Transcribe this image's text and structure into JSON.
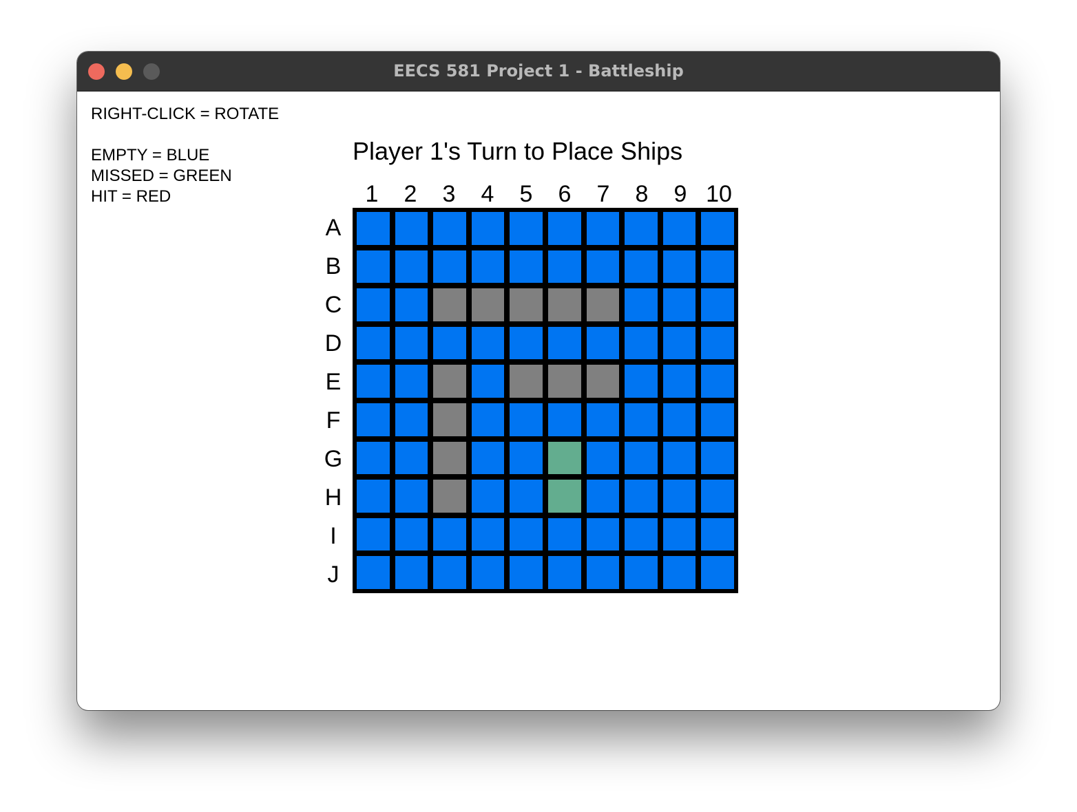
{
  "window": {
    "title": "EECS 581 Project 1 - Battleship"
  },
  "legend": {
    "rotate": "RIGHT-CLICK = ROTATE",
    "empty": "EMPTY = BLUE",
    "missed": "MISSED = GREEN",
    "hit": "HIT = RED"
  },
  "heading": "Player 1's Turn to Place Ships",
  "board": {
    "columns": [
      "1",
      "2",
      "3",
      "4",
      "5",
      "6",
      "7",
      "8",
      "9",
      "10"
    ],
    "rows": [
      "A",
      "B",
      "C",
      "D",
      "E",
      "F",
      "G",
      "H",
      "I",
      "J"
    ],
    "colors": {
      "empty": "#0075f2",
      "ship": "#808080",
      "preview": "#63ad8f"
    },
    "cells": [
      [
        "empty",
        "empty",
        "empty",
        "empty",
        "empty",
        "empty",
        "empty",
        "empty",
        "empty",
        "empty"
      ],
      [
        "empty",
        "empty",
        "empty",
        "empty",
        "empty",
        "empty",
        "empty",
        "empty",
        "empty",
        "empty"
      ],
      [
        "empty",
        "empty",
        "ship",
        "ship",
        "ship",
        "ship",
        "ship",
        "empty",
        "empty",
        "empty"
      ],
      [
        "empty",
        "empty",
        "empty",
        "empty",
        "empty",
        "empty",
        "empty",
        "empty",
        "empty",
        "empty"
      ],
      [
        "empty",
        "empty",
        "ship",
        "empty",
        "ship",
        "ship",
        "ship",
        "empty",
        "empty",
        "empty"
      ],
      [
        "empty",
        "empty",
        "ship",
        "empty",
        "empty",
        "empty",
        "empty",
        "empty",
        "empty",
        "empty"
      ],
      [
        "empty",
        "empty",
        "ship",
        "empty",
        "empty",
        "preview",
        "empty",
        "empty",
        "empty",
        "empty"
      ],
      [
        "empty",
        "empty",
        "ship",
        "empty",
        "empty",
        "preview",
        "empty",
        "empty",
        "empty",
        "empty"
      ],
      [
        "empty",
        "empty",
        "empty",
        "empty",
        "empty",
        "empty",
        "empty",
        "empty",
        "empty",
        "empty"
      ],
      [
        "empty",
        "empty",
        "empty",
        "empty",
        "empty",
        "empty",
        "empty",
        "empty",
        "empty",
        "empty"
      ]
    ]
  }
}
